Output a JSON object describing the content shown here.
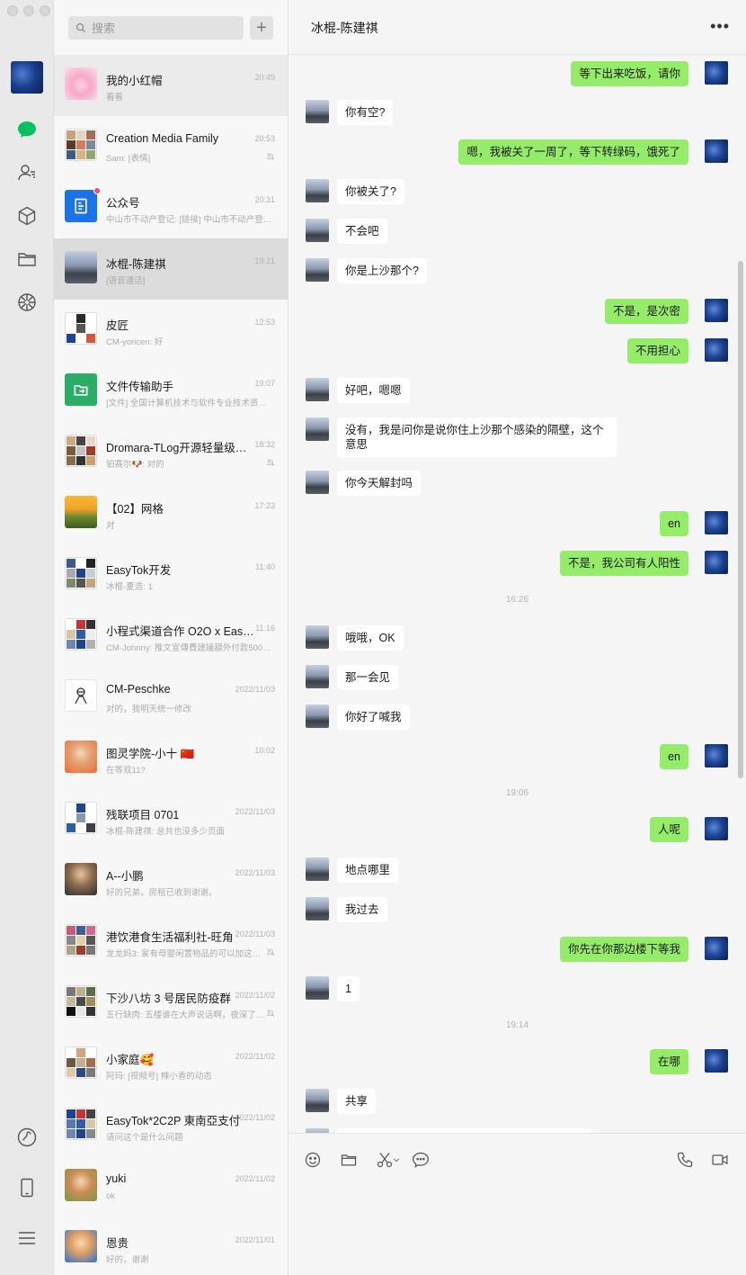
{
  "search": {
    "placeholder": "搜索",
    "add_label": "+"
  },
  "conversations": [
    {
      "name": "我的小红帽",
      "time": "20:49",
      "preview": "看看"
    },
    {
      "name": "Creation Media Family",
      "time": "20:53",
      "preview": "Sam: [表情]"
    },
    {
      "name": "公众号",
      "time": "20:31",
      "preview": "中山市不动产登记: [链接] 中山市不动产登记中心…"
    },
    {
      "name": "冰棍-陈建祺",
      "time": "19:21",
      "preview": "[语音通话]"
    },
    {
      "name": "皮匠",
      "time": "12:53",
      "preview": "CM-yoricen: 好"
    },
    {
      "name": "文件传输助手",
      "time": "19:07",
      "preview": "[文件] 全国计算机技术与软件专业技术资格…"
    },
    {
      "name": "Dromara-TLog开源轻量级日…",
      "time": "18:32",
      "preview": "铂赛尔🐶: 对的"
    },
    {
      "name": "【02】网格",
      "time": "17:23",
      "preview": "对"
    },
    {
      "name": "EasyTok开发",
      "time": "11:40",
      "preview": "冰棍-夏浩: 1"
    },
    {
      "name": "小程式渠道合作 O2O x EasyTok",
      "time": "11:16",
      "preview": "CM-Johnny: 推文宣傳費建議額外付款5000…"
    },
    {
      "name": "CM-Peschke",
      "time": "2022/11/03",
      "preview": "对的，我明天统一修改"
    },
    {
      "name": "图灵学院-小十 🇨🇳",
      "time": "10:02",
      "preview": "在等双11?"
    },
    {
      "name": "残联项目 0701",
      "time": "2022/11/03",
      "preview": "冰棍-陈建祺: 总共也没多少页面"
    },
    {
      "name": "A--小鹏",
      "time": "2022/11/03",
      "preview": "好的兄弟，房租已收到谢谢。"
    },
    {
      "name": "港饮港食生活福利社-旺角",
      "time": "2022/11/03",
      "preview": "龙龙妈3: 家有母婴闲置物品的可以加这…"
    },
    {
      "name": "下沙八坊 3 号居民防疫群",
      "time": "2022/11/02",
      "preview": "五行缺肉: 五楼谁在大声说话啊，夜深了…"
    },
    {
      "name": "小家庭🥰",
      "time": "2022/11/02",
      "preview": "阿玛: [视频号] 辣小香的动态"
    },
    {
      "name": "EasyTok*2C2P 東南亞支付",
      "time": "2022/11/02",
      "preview": "请问这个是什么问题"
    },
    {
      "name": "yuki",
      "time": "2022/11/02",
      "preview": "ok"
    },
    {
      "name": "恩贵",
      "time": "2022/11/01",
      "preview": "好的，谢谢"
    }
  ],
  "chat": {
    "title": "冰棍-陈建祺",
    "more_label": "•••",
    "messages": [
      {
        "from": "me",
        "text": "等下出来吃饭，请你"
      },
      {
        "from": "peer",
        "text": "你有空?"
      },
      {
        "from": "me",
        "text": "嗯，我被关了一周了，等下转绿码，饿死了"
      },
      {
        "from": "peer",
        "text": "你被关了?"
      },
      {
        "from": "peer",
        "text": "不会吧"
      },
      {
        "from": "peer",
        "text": "你是上沙那个?"
      },
      {
        "from": "me",
        "text": "不是，是次密"
      },
      {
        "from": "me",
        "text": "不用担心"
      },
      {
        "from": "peer",
        "text": "好吧，嗯嗯"
      },
      {
        "from": "peer",
        "text": "没有，我是问你是说你住上沙那个感染的隔壁，这个意思"
      },
      {
        "from": "peer",
        "text": "你今天解封吗"
      },
      {
        "from": "me",
        "text": "en"
      },
      {
        "from": "me",
        "text": "不是，我公司有人阳性"
      },
      {
        "timestamp": "16:26"
      },
      {
        "from": "peer",
        "text": "哦哦，OK"
      },
      {
        "from": "peer",
        "text": "那一会见"
      },
      {
        "from": "peer",
        "text": "你好了喊我"
      },
      {
        "from": "me",
        "text": "en"
      },
      {
        "timestamp": "19:06"
      },
      {
        "from": "me",
        "text": "人呢"
      },
      {
        "from": "peer",
        "text": "地点哪里"
      },
      {
        "from": "peer",
        "text": "我过去"
      },
      {
        "from": "me",
        "text": "你先在你那边楼下等我"
      },
      {
        "from": "peer",
        "text": "1"
      },
      {
        "timestamp": "19:14"
      },
      {
        "from": "me",
        "text": "在哪"
      },
      {
        "from": "peer",
        "text": "共享"
      }
    ]
  },
  "icons": {
    "rail": [
      "chat-icon",
      "contacts-icon",
      "box-icon",
      "folder-icon",
      "moments-icon",
      "miniprogram-icon",
      "phone-icon",
      "menu-icon"
    ],
    "toolbar": [
      "emoji-icon",
      "folder-icon",
      "scissors-icon",
      "chat-bubble-icon",
      "phone-icon",
      "video-icon"
    ]
  },
  "colors": {
    "accent": "#07c160",
    "bubble_out": "#95ec69",
    "bubble_in": "#ffffff"
  }
}
